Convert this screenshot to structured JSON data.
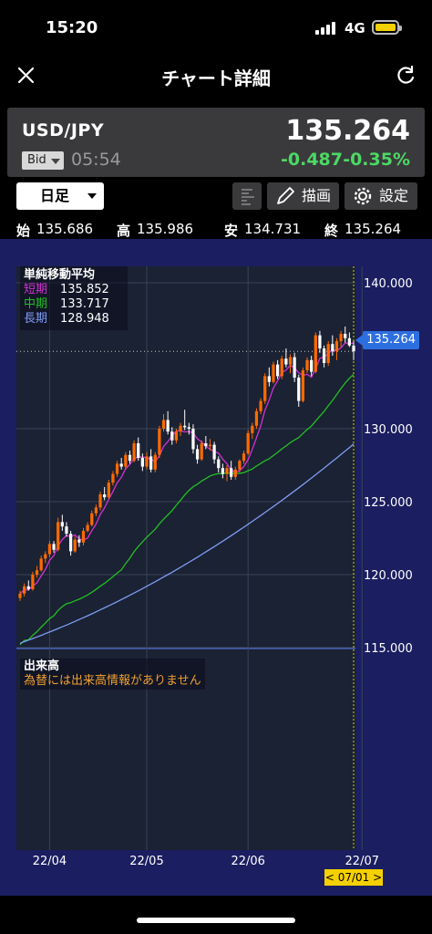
{
  "status_bar": {
    "time": "15:20",
    "network": "4G"
  },
  "header": {
    "title": "チャート詳細"
  },
  "quote": {
    "symbol": "USD/JPY",
    "price": "135.264",
    "price_type": "Bid",
    "time": "05:54",
    "change": "-0.487",
    "change_pct": "-0.35%"
  },
  "toolbar": {
    "timeframe": "日足",
    "draw_label": "描画",
    "settings_label": "設定"
  },
  "ohlc": {
    "open_label": "始",
    "open": "135.686",
    "high_label": "高",
    "high": "135.986",
    "low_label": "安",
    "low": "134.731",
    "close_label": "終",
    "close": "135.264"
  },
  "legend": {
    "title": "単純移動平均",
    "short_label": "短期",
    "short_value": "135.852",
    "mid_label": "中期",
    "mid_value": "133.717",
    "long_label": "長期",
    "long_value": "128.948"
  },
  "volume": {
    "title": "出来高",
    "message": "為替には出来高情報がありません"
  },
  "current_price_tag": "135.264",
  "current_date_tag": "< 07/01 >",
  "colors": {
    "chart_bg": "#1b1e60",
    "up": "#ff6a00",
    "down": "#ffffff",
    "sma_short": "#d431d4",
    "sma_mid": "#22c022",
    "sma_long": "#7f9cf5",
    "positive_change": "#4cd964"
  },
  "chart_data": {
    "type": "candlestick",
    "y_ticks": [
      "140.000",
      "130.000",
      "125.000",
      "120.000",
      "115.000"
    ],
    "ylim": [
      115,
      140
    ],
    "x_ticks": [
      "22/04",
      "22/05",
      "22/06",
      "22/07"
    ],
    "x_tick_index": [
      7,
      30,
      54,
      81
    ],
    "candles": [
      [
        118.4,
        118.9,
        118.2,
        118.7
      ],
      [
        118.7,
        119.4,
        118.5,
        119.2
      ],
      [
        119.2,
        119.6,
        118.9,
        119.0
      ],
      [
        119.0,
        120.2,
        118.9,
        120.0
      ],
      [
        120.0,
        120.6,
        119.8,
        120.3
      ],
      [
        120.3,
        121.3,
        120.2,
        121.1
      ],
      [
        121.1,
        121.6,
        120.8,
        121.4
      ],
      [
        121.4,
        122.3,
        121.2,
        122.1
      ],
      [
        122.1,
        122.3,
        121.5,
        121.7
      ],
      [
        121.7,
        123.9,
        121.6,
        123.6
      ],
      [
        123.6,
        124.1,
        123.0,
        123.3
      ],
      [
        123.3,
        123.6,
        122.6,
        122.8
      ],
      [
        122.8,
        123.0,
        121.3,
        121.6
      ],
      [
        121.6,
        122.6,
        121.5,
        122.4
      ],
      [
        122.4,
        122.7,
        121.9,
        122.2
      ],
      [
        122.2,
        123.2,
        122.0,
        123.0
      ],
      [
        123.0,
        123.6,
        122.9,
        123.4
      ],
      [
        123.4,
        124.4,
        123.3,
        124.2
      ],
      [
        124.2,
        124.8,
        124.0,
        124.6
      ],
      [
        124.6,
        125.7,
        124.4,
        125.5
      ],
      [
        125.5,
        126.0,
        125.1,
        125.3
      ],
      [
        125.3,
        126.5,
        125.2,
        126.3
      ],
      [
        126.3,
        127.1,
        126.1,
        126.9
      ],
      [
        126.9,
        127.8,
        126.7,
        127.6
      ],
      [
        127.6,
        128.0,
        127.2,
        127.4
      ],
      [
        127.4,
        128.4,
        127.2,
        128.2
      ],
      [
        128.2,
        128.5,
        127.6,
        127.8
      ],
      [
        127.8,
        129.2,
        127.7,
        129.0
      ],
      [
        129.0,
        129.4,
        127.8,
        128.0
      ],
      [
        128.0,
        128.3,
        127.1,
        127.4
      ],
      [
        127.4,
        128.4,
        127.2,
        128.1
      ],
      [
        128.1,
        128.6,
        127.0,
        127.2
      ],
      [
        127.2,
        128.4,
        127.0,
        128.2
      ],
      [
        128.2,
        130.2,
        128.0,
        130.0
      ],
      [
        130.0,
        131.0,
        129.8,
        130.6
      ],
      [
        130.6,
        131.2,
        129.6,
        129.8
      ],
      [
        129.8,
        130.1,
        128.9,
        129.2
      ],
      [
        129.2,
        130.0,
        129.0,
        129.8
      ],
      [
        129.8,
        130.4,
        129.5,
        130.2
      ],
      [
        130.2,
        131.3,
        129.9,
        130.1
      ],
      [
        130.1,
        130.4,
        129.6,
        130.0
      ],
      [
        130.0,
        130.3,
        128.3,
        128.6
      ],
      [
        128.6,
        128.9,
        127.6,
        127.9
      ],
      [
        127.9,
        129.2,
        127.8,
        129.0
      ],
      [
        129.0,
        129.5,
        128.6,
        128.8
      ],
      [
        128.8,
        129.3,
        128.5,
        128.9
      ],
      [
        128.9,
        129.1,
        127.6,
        127.9
      ],
      [
        127.9,
        128.1,
        127.0,
        127.3
      ],
      [
        127.3,
        127.6,
        126.6,
        126.9
      ],
      [
        126.9,
        127.5,
        126.4,
        127.3
      ],
      [
        127.3,
        127.8,
        126.5,
        126.7
      ],
      [
        126.7,
        127.4,
        126.5,
        127.2
      ],
      [
        127.2,
        127.9,
        127.0,
        127.8
      ],
      [
        127.8,
        128.5,
        127.6,
        128.3
      ],
      [
        128.3,
        129.9,
        128.2,
        129.7
      ],
      [
        129.7,
        130.4,
        129.3,
        130.2
      ],
      [
        130.2,
        131.4,
        130.0,
        131.2
      ],
      [
        131.2,
        132.1,
        131.0,
        131.9
      ],
      [
        131.9,
        133.8,
        131.7,
        133.6
      ],
      [
        133.6,
        134.2,
        132.9,
        133.2
      ],
      [
        133.2,
        134.6,
        133.1,
        134.4
      ],
      [
        134.4,
        134.7,
        133.4,
        133.6
      ],
      [
        133.6,
        135.0,
        133.4,
        134.8
      ],
      [
        134.8,
        135.5,
        134.2,
        134.4
      ],
      [
        134.4,
        135.1,
        133.8,
        134.9
      ],
      [
        134.9,
        135.2,
        133.2,
        133.5
      ],
      [
        133.5,
        133.7,
        131.5,
        131.9
      ],
      [
        131.9,
        134.2,
        131.8,
        134.0
      ],
      [
        134.0,
        134.9,
        133.8,
        134.7
      ],
      [
        134.7,
        135.0,
        133.6,
        133.9
      ],
      [
        133.9,
        136.6,
        133.8,
        136.4
      ],
      [
        136.4,
        136.7,
        135.2,
        135.5
      ],
      [
        135.5,
        135.7,
        134.2,
        134.5
      ],
      [
        134.5,
        136.0,
        134.3,
        135.8
      ],
      [
        135.8,
        136.4,
        135.0,
        135.3
      ],
      [
        135.3,
        136.2,
        134.7,
        136.0
      ],
      [
        136.0,
        136.7,
        135.6,
        136.5
      ],
      [
        136.5,
        137.0,
        135.9,
        136.2
      ],
      [
        136.2,
        136.6,
        135.6,
        135.7
      ],
      [
        135.7,
        136.0,
        134.7,
        135.3
      ]
    ],
    "sma_short_end": 135.852,
    "sma_mid_end": 133.717,
    "sma_long_end": 128.948
  }
}
